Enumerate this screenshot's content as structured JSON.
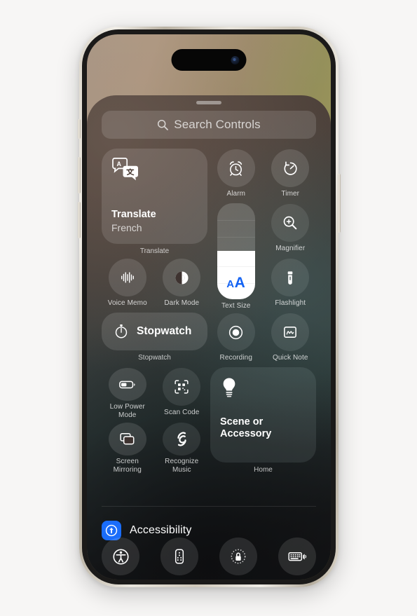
{
  "device": {
    "name": "iPhone",
    "frame_label": "iphone-frame"
  },
  "search": {
    "placeholder": "Search Controls",
    "icon": "search-icon"
  },
  "controls": {
    "translate": {
      "title": "Translate",
      "subtitle": "French",
      "caption": "Translate",
      "icon": "translate-bubbles-icon"
    },
    "alarm": {
      "label": "Alarm",
      "icon": "alarm-clock-icon"
    },
    "timer": {
      "label": "Timer",
      "icon": "timer-icon"
    },
    "magnifier": {
      "label": "Magnifier",
      "icon": "magnifier-plus-icon"
    },
    "text_size": {
      "label": "Text Size",
      "icon": "text-size-aa-icon",
      "small_glyph": "A",
      "large_glyph": "A",
      "fill_percent": 50,
      "accent_color": "#1463f3"
    },
    "voice_memo": {
      "label": "Voice Memo",
      "icon": "waveform-icon"
    },
    "dark_mode": {
      "label": "Dark Mode",
      "icon": "dark-mode-circle-icon"
    },
    "flashlight": {
      "label": "Flashlight",
      "icon": "flashlight-icon"
    },
    "stopwatch": {
      "label": "Stopwatch",
      "caption": "Stopwatch",
      "icon": "stopwatch-icon"
    },
    "recording": {
      "label": "Recording",
      "icon": "screen-record-icon"
    },
    "quick_note": {
      "label": "Quick Note",
      "icon": "quick-note-icon"
    },
    "low_power_mode": {
      "label_line1": "Low Power",
      "label_line2": "Mode",
      "icon": "battery-icon"
    },
    "scan_code": {
      "label": "Scan Code",
      "icon": "qr-scan-icon"
    },
    "screen_mirroring": {
      "label_line1": "Screen",
      "label_line2": "Mirroring",
      "icon": "screen-mirroring-icon"
    },
    "recognize_music": {
      "label_line1": "Recognize",
      "label_line2": "Music",
      "icon": "shazam-icon"
    },
    "home_scene": {
      "title_line1": "Scene or",
      "title_line2": "Accessory",
      "caption": "Home",
      "icon": "lightbulb-icon"
    }
  },
  "accessibility": {
    "label": "Accessibility",
    "icon": "accessibility-badge-icon",
    "badge_color": "#1a6dfa"
  },
  "dock": [
    {
      "name": "accessibility-shortcut",
      "icon": "accessibility-person-icon"
    },
    {
      "name": "remote",
      "icon": "apple-tv-remote-icon"
    },
    {
      "name": "screen-lock",
      "icon": "rotation-lock-icon"
    },
    {
      "name": "hearing",
      "icon": "keyboard-sound-icon"
    }
  ],
  "theme": {
    "sheet_dark": "#1a1b1d",
    "tile_fill": "rgba(255,255,255,0.12)",
    "text_primary": "#ffffff"
  }
}
